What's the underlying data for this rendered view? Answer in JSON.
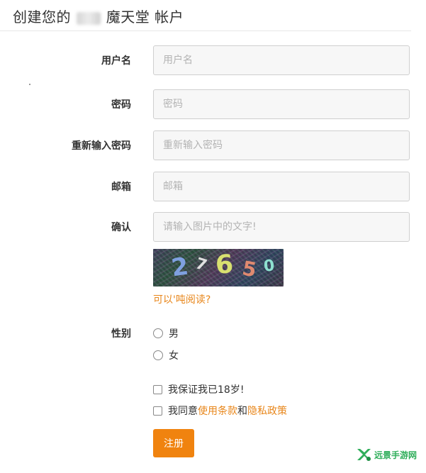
{
  "header": {
    "title_prefix": "创建您的",
    "title_suffix": "魔天堂 帐户"
  },
  "form": {
    "username": {
      "label": "用户名",
      "placeholder": "用户名"
    },
    "password": {
      "label": "密码",
      "placeholder": "密码"
    },
    "password_confirm": {
      "label": "重新输入密码",
      "placeholder": "重新输入密码"
    },
    "email": {
      "label": "邮箱",
      "placeholder": "邮箱"
    },
    "captcha": {
      "label": "确认",
      "placeholder": "请输入图片中的文字!",
      "chars": [
        "2",
        "7",
        "6",
        "5",
        "0"
      ],
      "unreadable_link": "可以'吨阅读?"
    },
    "gender": {
      "label": "性别",
      "options": [
        "男",
        "女"
      ]
    },
    "age_check": {
      "text": "我保证我已18岁!"
    },
    "terms_check": {
      "prefix": "我同意",
      "terms_link": "使用条款",
      "conj": "和",
      "privacy_link": "隐私政策"
    },
    "submit_label": "注册"
  },
  "watermark": {
    "text": "远景手游网"
  },
  "colors": {
    "accent": "#f0830f",
    "link": "#e8861a",
    "watermark": "#2fae5a"
  }
}
